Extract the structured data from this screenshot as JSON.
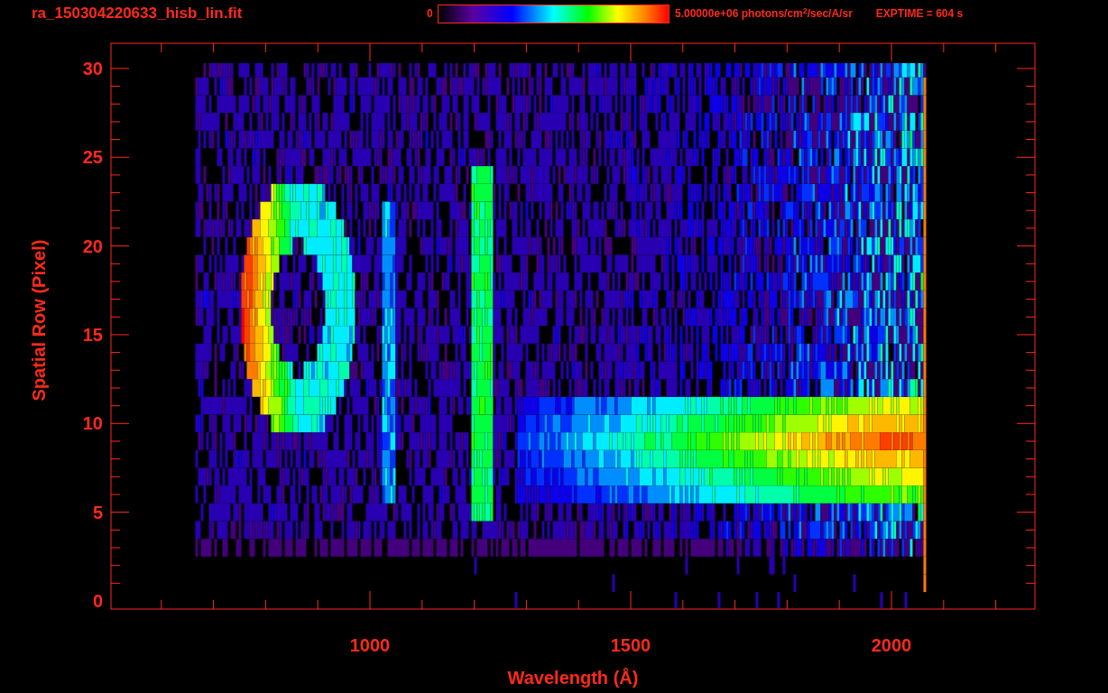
{
  "title": "ra_150304220633_hisb_lin.fit",
  "colorbar": {
    "min_label": "0",
    "max_label": "5.00000e+06 photons/cm$^{2}$/sec/A/sr"
  },
  "exposure": "EXPTIME = 604 s",
  "plot": {
    "xlabel": "Wavelength (Å)",
    "ylabel": "Spatial Row (Pixel)",
    "xticks": [
      "1000",
      "1500",
      "2000"
    ],
    "yticks": [
      "30",
      "25",
      "20",
      "15",
      "10",
      "5",
      "0"
    ]
  }
}
